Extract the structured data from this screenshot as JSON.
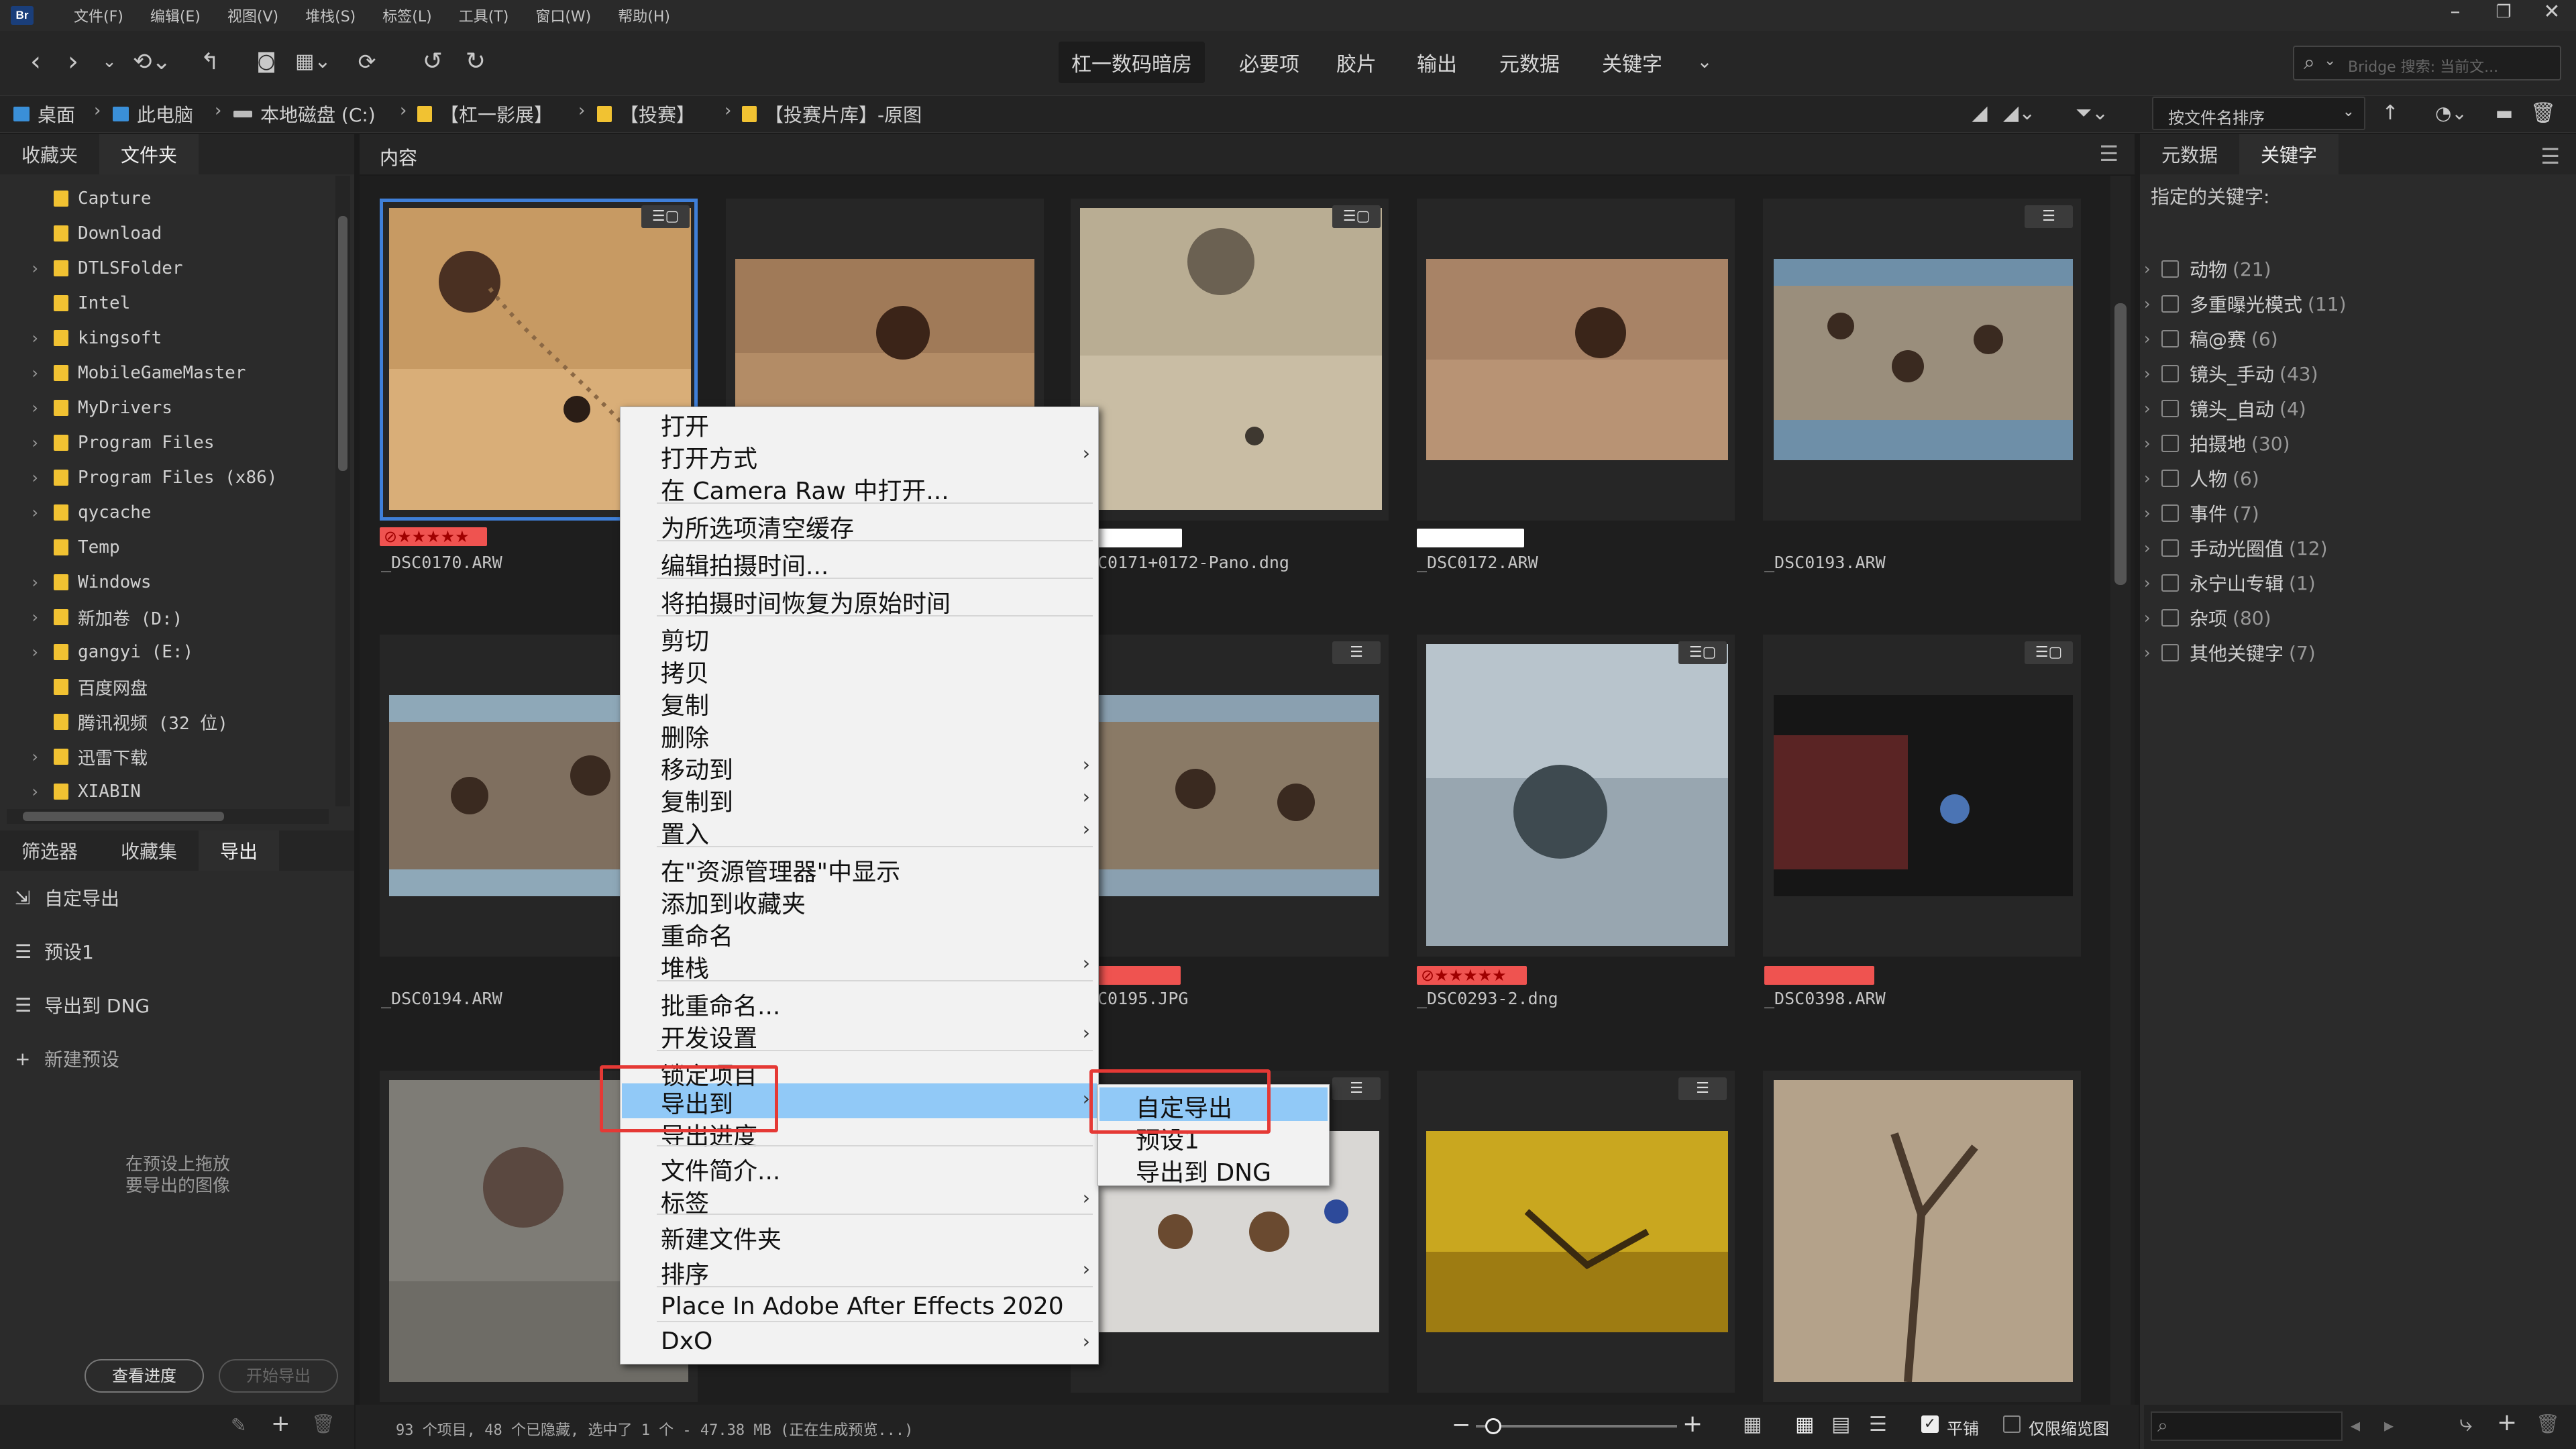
{
  "app": {
    "logo": "Br"
  },
  "menubar": [
    "文件(F)",
    "编辑(E)",
    "视图(V)",
    "堆栈(S)",
    "标签(L)",
    "工具(T)",
    "窗口(W)",
    "帮助(H)"
  ],
  "window_controls": {
    "minimize": "–",
    "restore": "❐",
    "close": "✕"
  },
  "workspace_tabs": [
    "杠一数码暗房",
    "必要项",
    "胶片",
    "输出",
    "元数据",
    "关键字"
  ],
  "search": {
    "placeholder": "Bridge 搜索: 当前文..."
  },
  "breadcrumb": [
    "桌面",
    "此电脑",
    "本地磁盘 (C:)",
    "【杠一影展】",
    "【投赛】",
    "【投赛片库】-原图"
  ],
  "sort": {
    "label": "按文件名排序"
  },
  "left_top_tabs": [
    "收藏夹",
    "文件夹"
  ],
  "folders": [
    {
      "label": "Capture",
      "expand": false
    },
    {
      "label": "Download",
      "expand": false
    },
    {
      "label": "DTLSFolder",
      "expand": true
    },
    {
      "label": "Intel",
      "expand": false
    },
    {
      "label": "kingsoft",
      "expand": true
    },
    {
      "label": "MobileGameMaster",
      "expand": true
    },
    {
      "label": "MyDrivers",
      "expand": true
    },
    {
      "label": "Program Files",
      "expand": true
    },
    {
      "label": "Program Files (x86)",
      "expand": true
    },
    {
      "label": "qycache",
      "expand": true
    },
    {
      "label": "Temp",
      "expand": false
    },
    {
      "label": "Windows",
      "expand": true
    },
    {
      "label": "新加卷 (D:)",
      "expand": true
    },
    {
      "label": "gangyi (E:)",
      "expand": true
    },
    {
      "label": "百度网盘",
      "expand": false
    },
    {
      "label": "腾讯视频 (32 位)",
      "expand": false
    },
    {
      "label": "迅雷下载",
      "expand": true
    },
    {
      "label": "XIABIN",
      "expand": true
    }
  ],
  "left_bottom_tabs": [
    "筛选器",
    "收藏集",
    "导出"
  ],
  "export_items": [
    {
      "icon": "export-icon",
      "label": "自定导出"
    },
    {
      "icon": "list-icon",
      "label": "预设1"
    },
    {
      "icon": "list-icon",
      "label": "导出到 DNG"
    },
    {
      "icon": "plus-icon",
      "label": "新建预设"
    }
  ],
  "export_hint": "在预设上拖放\n要导出的图像",
  "export_buttons": {
    "progress": "查看进度",
    "start": "开始导出"
  },
  "content_panel": {
    "title": "内容"
  },
  "thumbnails": [
    {
      "name": "_DSC0170.ARW",
      "rating": "★★★★★",
      "label_color": "#e53935",
      "selected": true
    },
    {
      "name": "",
      "rating": "",
      "label_color": "",
      "selected": false
    },
    {
      "name": "C0171+0172-Pano.dng",
      "rating": "",
      "label_color": "#ffffff",
      "selected": false
    },
    {
      "name": "_DSC0172.ARW",
      "rating": "",
      "label_color": "#ffffff",
      "selected": false
    },
    {
      "name": "_DSC0193.ARW",
      "rating": "",
      "label_color": "",
      "selected": false
    },
    {
      "name": "_DSC0194.ARW",
      "rating": "",
      "label_color": "",
      "selected": false
    },
    {
      "name": "C0195.JPG",
      "rating": "",
      "label_color": "#ef5350",
      "selected": false
    },
    {
      "name": "_DSC0293-2.dng",
      "rating": "★★★★★",
      "label_color": "#ef5350",
      "selected": false
    },
    {
      "name": "_DSC0398.ARW",
      "rating": "",
      "label_color": "#ef5350",
      "selected": false
    }
  ],
  "context_menu": [
    {
      "label": "打开",
      "arrow": false
    },
    {
      "label": "打开方式",
      "arrow": true
    },
    {
      "label": "在 Camera Raw 中打开...",
      "arrow": false
    },
    {
      "label": "为所选项清空缓存",
      "arrow": false
    },
    {
      "label": "编辑拍摄时间...",
      "arrow": false
    },
    {
      "label": "将拍摄时间恢复为原始时间",
      "arrow": false
    },
    {
      "label": "剪切",
      "arrow": false
    },
    {
      "label": "拷贝",
      "arrow": false
    },
    {
      "label": "复制",
      "arrow": false
    },
    {
      "label": "删除",
      "arrow": false
    },
    {
      "label": "移动到",
      "arrow": true
    },
    {
      "label": "复制到",
      "arrow": true
    },
    {
      "label": "置入",
      "arrow": true
    },
    {
      "label": "在\"资源管理器\"中显示",
      "arrow": false
    },
    {
      "label": "添加到收藏夹",
      "arrow": false
    },
    {
      "label": "重命名",
      "arrow": false
    },
    {
      "label": "堆栈",
      "arrow": true
    },
    {
      "label": "批重命名...",
      "arrow": false
    },
    {
      "label": "开发设置",
      "arrow": true
    },
    {
      "label": "锁定项目",
      "arrow": false
    },
    {
      "label": "导出到",
      "arrow": true
    },
    {
      "label": "导出进度",
      "arrow": false
    },
    {
      "label": "文件简介...",
      "arrow": false
    },
    {
      "label": "标签",
      "arrow": true
    },
    {
      "label": "新建文件夹",
      "arrow": false
    },
    {
      "label": "排序",
      "arrow": true
    },
    {
      "label": "Place In Adobe After Effects 2020",
      "arrow": false
    },
    {
      "label": "DxO",
      "arrow": true
    }
  ],
  "submenu": [
    "自定导出",
    "预设1",
    "导出到 DNG"
  ],
  "right_tabs": [
    "元数据",
    "关键字"
  ],
  "keywords_heading": "指定的关键字:",
  "keywords": [
    {
      "label": "动物",
      "count": "(21)"
    },
    {
      "label": "多重曝光模式",
      "count": "(11)"
    },
    {
      "label": "稿@赛",
      "count": "(6)"
    },
    {
      "label": "镜头_手动",
      "count": "(43)"
    },
    {
      "label": "镜头_自动",
      "count": "(4)"
    },
    {
      "label": "拍摄地",
      "count": "(30)"
    },
    {
      "label": "人物",
      "count": "(6)"
    },
    {
      "label": "事件",
      "count": "(7)"
    },
    {
      "label": "手动光圈值",
      "count": "(12)"
    },
    {
      "label": "永宁山专辑",
      "count": "(1)"
    },
    {
      "label": "杂项",
      "count": "(80)"
    },
    {
      "label": "其他关键字",
      "count": "(7)"
    }
  ],
  "status": {
    "text": "93 个项目, 48 个已隐藏, 选中了 1 个 - 47.38 MB (正在生成预览...)"
  },
  "view_options": {
    "tile": "平铺",
    "thumbs_only": "仅限缩览图"
  }
}
